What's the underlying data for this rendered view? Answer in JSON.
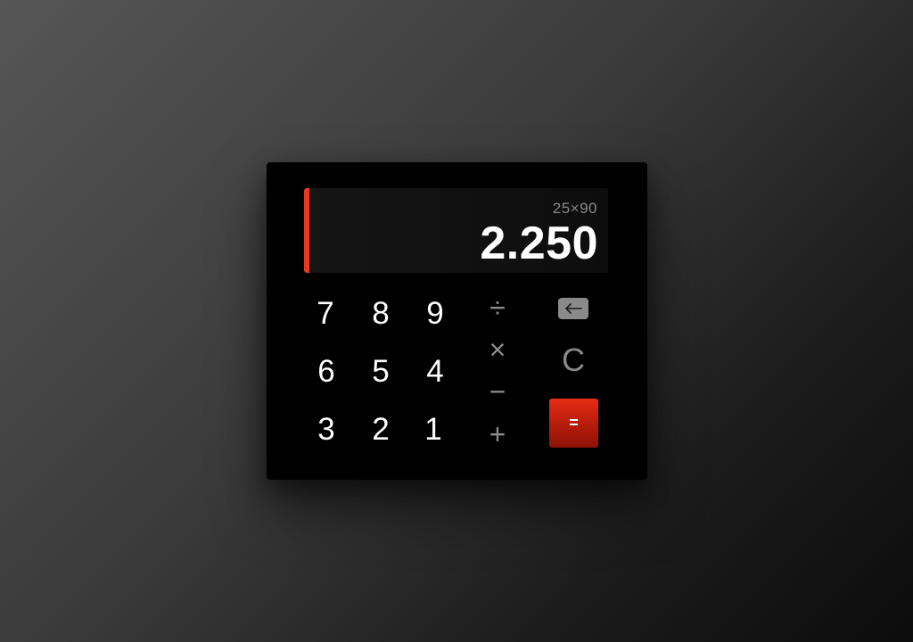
{
  "display": {
    "expression": "25×90",
    "result": "2.250",
    "accent_color": "#e8381f"
  },
  "keypad": {
    "digits": {
      "k7": "7",
      "k8": "8",
      "k9": "9",
      "k6": "6",
      "k5": "5",
      "k4": "4",
      "k3": "3",
      "k2": "2",
      "k1": "1"
    },
    "operators": {
      "divide": "÷",
      "multiply": "×",
      "subtract": "−",
      "add": "+"
    },
    "backspace_icon": "backspace-arrow-left-icon",
    "clear": "C",
    "equals": "=",
    "equals_color": "#e62d14"
  }
}
